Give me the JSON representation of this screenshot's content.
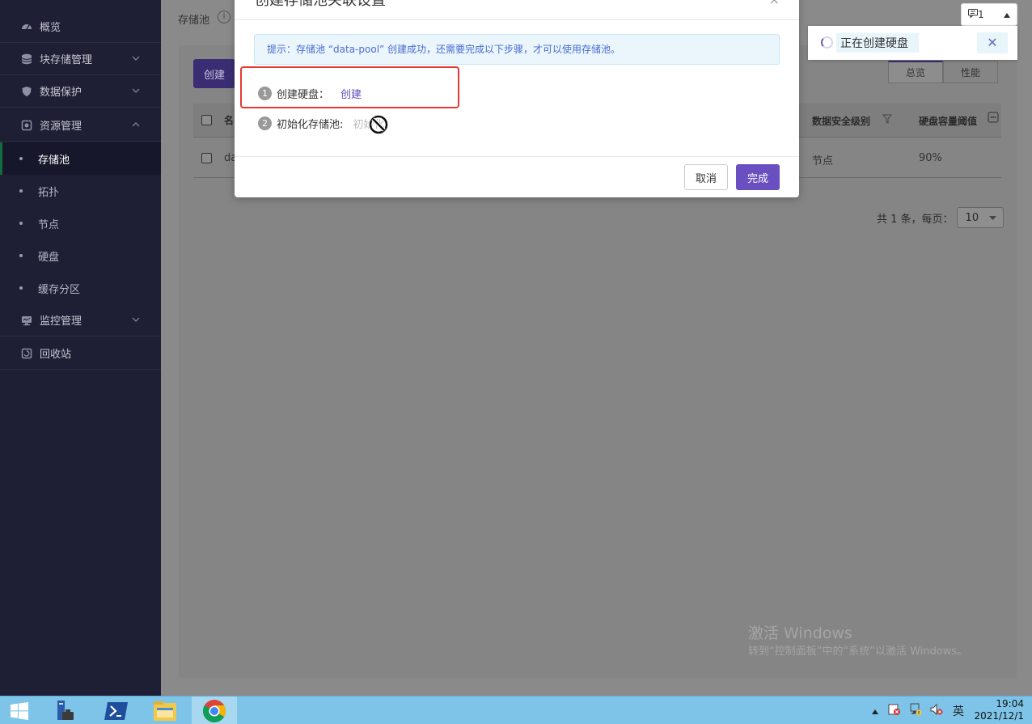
{
  "breadcrumb": {
    "title": "存储池",
    "info_icon": "i"
  },
  "sidebar": {
    "items": [
      {
        "label": "概览",
        "icon": "dashboard-icon",
        "expandable": false
      },
      {
        "label": "块存储管理",
        "icon": "database-icon",
        "expandable": true
      },
      {
        "label": "数据保护",
        "icon": "shield-icon",
        "expandable": true
      },
      {
        "label": "资源管理",
        "icon": "resource-icon",
        "expandable": true,
        "expanded": true
      },
      {
        "label": "监控管理",
        "icon": "monitor-icon",
        "expandable": true
      },
      {
        "label": "回收站",
        "icon": "recycle-icon",
        "expandable": false
      }
    ],
    "sub_items": [
      {
        "label": "存储池",
        "active": true
      },
      {
        "label": "拓扑",
        "active": false
      },
      {
        "label": "节点",
        "active": false
      },
      {
        "label": "硬盘",
        "active": false
      },
      {
        "label": "缓存分区",
        "active": false
      }
    ],
    "chevron_down": "⌄",
    "chevron_up": "^"
  },
  "main": {
    "create_button": "创建",
    "tabs": [
      {
        "label": "总览",
        "active": true
      },
      {
        "label": "性能",
        "active": false
      }
    ],
    "table": {
      "headers": {
        "name": "名",
        "security_level": "数据安全级别",
        "capacity_threshold": "硬盘容量阈值"
      },
      "rows": [
        {
          "name": "da",
          "security_level": "节点",
          "capacity_threshold": "90%"
        }
      ]
    },
    "pagination": {
      "summary": "共 1 条，每页：",
      "page_size": "10"
    }
  },
  "notification": {
    "count": "1",
    "toast_text": "正在创建硬盘",
    "close": "✕"
  },
  "modal": {
    "title": "创建存储池关联设置",
    "close": "×",
    "tip": "提示：存储池 “data-pool” 创建成功，还需要完成以下步骤，才可以使用存储池。",
    "steps": [
      {
        "num": "1",
        "label": "创建硬盘：",
        "action": "创建"
      },
      {
        "num": "2",
        "label": "初始化存储池:",
        "action": "初始化"
      }
    ],
    "cancel_button": "取消",
    "done_button": "完成"
  },
  "watermark": {
    "line1": "激活 Windows",
    "line2": "转到“控制面板”中的“系统”以激活 Windows。"
  },
  "taskbar": {
    "apps": [
      "server-manager-icon",
      "powershell-icon",
      "file-explorer-icon",
      "chrome-icon"
    ],
    "tray_lang": "英",
    "time": "19:04",
    "date": "2021/12/1"
  },
  "colors": {
    "accent": "#6a4fc0",
    "sidebar_bg": "#1e1f35",
    "highlight_box": "#e53935",
    "tip_text": "#4a6bd0",
    "taskbar": "#7ec4e8"
  }
}
